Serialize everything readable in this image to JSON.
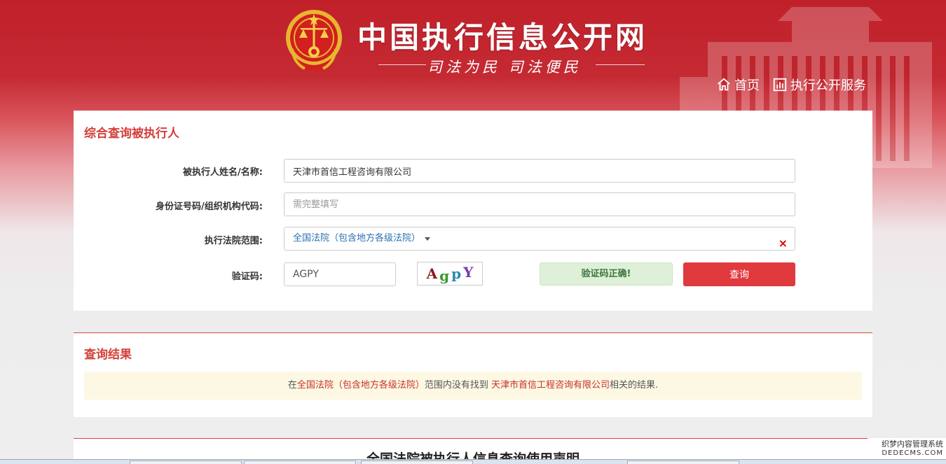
{
  "header": {
    "title": "中国执行信息公开网",
    "slogan": "司法为民   司法便民",
    "nav": [
      {
        "label": "首页",
        "icon": "home-icon"
      },
      {
        "label": "执行公开服务",
        "icon": "bar-chart-icon"
      }
    ]
  },
  "search": {
    "title": "综合查询被执行人",
    "name_label": "被执行人姓名/名称:",
    "name_value": "天津市首信工程咨询有限公司",
    "id_label": "身份证号码/组织机构代码:",
    "id_placeholder": "需完整填写",
    "court_label": "执行法院范围:",
    "court_value": "全国法院（包含地方各级法院）",
    "clear_symbol": "×",
    "captcha_label": "验证码:",
    "captcha_value": "AGPY",
    "captcha_chars": [
      {
        "ch": "A",
        "color": "#8b1a1a"
      },
      {
        "ch": "g",
        "color": "#3a9a2a"
      },
      {
        "ch": "p",
        "color": "#2a8ab0"
      },
      {
        "ch": "Y",
        "color": "#7a3ab0"
      }
    ],
    "captcha_status": "验证码正确!",
    "submit_label": "查询"
  },
  "result": {
    "title": "查询结果",
    "msg_prefix": "在",
    "msg_scope": "全国法院（包含地方各级法院）",
    "msg_middle": "范围内没有找到 ",
    "msg_name": "天津市首信工程咨询有限公司",
    "msg_suffix": "相关的结果."
  },
  "notice": {
    "title": "全国法院被执行人信息查询使用声明"
  },
  "watermark": {
    "line1": "织梦内容管理系统",
    "line2": "DEDECMS.COM"
  },
  "colors": {
    "brand_red": "#c0202a",
    "accent_red": "#d43f3a",
    "button_red": "#e0393e",
    "success_bg": "#dff0d8",
    "result_bg": "#fcf8e3"
  }
}
